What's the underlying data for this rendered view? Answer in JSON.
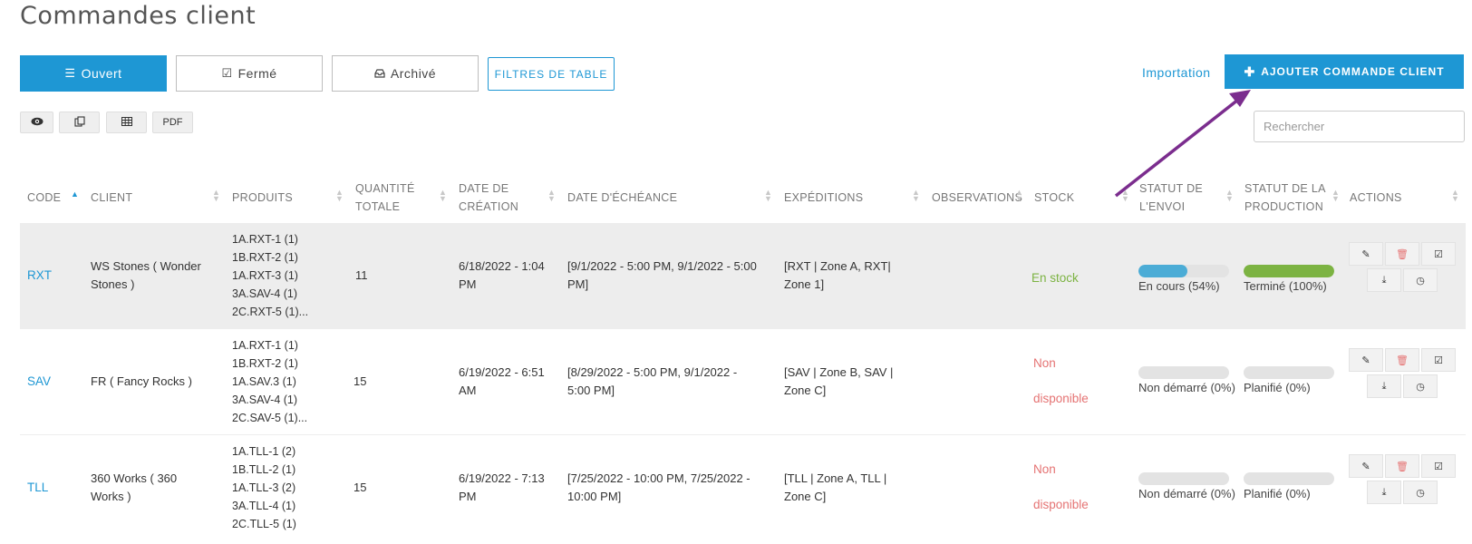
{
  "page": {
    "title": "Commandes client"
  },
  "tabs": {
    "open": {
      "label": "Ouvert",
      "icon": "list-icon"
    },
    "closed": {
      "label": "Fermé",
      "icon": "checkbox-icon"
    },
    "archived": {
      "label": "Archivé",
      "icon": "inbox-icon"
    }
  },
  "toolbar": {
    "filters_label": "FILTRES DE TABLE",
    "import_label": "Importation",
    "add_label": "AJOUTER COMMANDE CLIENT",
    "pdf_label": "PDF",
    "search_placeholder": "Rechercher"
  },
  "table": {
    "headers": {
      "code": "CODE",
      "client": "CLIENT",
      "products": "PRODUITS",
      "qty_l1": "QUANTITÉ",
      "qty_l2": "TOTALE",
      "created_l1": "DATE DE",
      "created_l2": "CRÉATION",
      "due": "DATE D'ÉCHÉANCE",
      "shipments": "EXPÉDITIONS",
      "observations": "OBSERVATIONS",
      "stock": "STOCK",
      "ship_status_l1": "STATUT DE",
      "ship_status_l2": "L'ENVOI",
      "prod_status_l1": "STATUT DE LA",
      "prod_status_l2": "PRODUCTION",
      "actions": "ACTIONS"
    },
    "sort_column": "CODE",
    "rows": [
      {
        "code": "RXT",
        "client_l1": "WS Stones ( Wonder",
        "client_l2": "Stones )",
        "products": [
          "1A.RXT-1 (1)",
          "1B.RXT-2 (1)",
          "1A.RXT-3 (1)",
          "3A.SAV-4 (1)",
          "2C.RXT-5 (1)..."
        ],
        "qty": "11",
        "created_l1": "6/18/2022 - 1:04",
        "created_l2": "PM",
        "due_l1": "[9/1/2022 - 5:00 PM, 9/1/2022 - 5:00",
        "due_l2": "PM]",
        "ship_l1": "[RXT | Zone A, RXT|",
        "ship_l2": "Zone 1]",
        "stock_l1": "En stock",
        "stock_l2": "",
        "stock_color": "#7cb342",
        "ship_status_label": "En cours (54%)",
        "ship_progress": 54,
        "ship_color": "#4bacd6",
        "prod_status_label": "Terminé (100%)",
        "prod_progress": 100,
        "prod_color": "#7cb342"
      },
      {
        "code": "SAV",
        "client_l1": "FR ( Fancy Rocks )",
        "client_l2": "",
        "products": [
          "1A.RXT-1 (1)",
          "1B.RXT-2 (1)",
          "1A.SAV.3 (1)",
          "3A.SAV-4 (1)",
          "2C.SAV-5 (1)..."
        ],
        "qty": "15",
        "created_l1": "6/19/2022 - 6:51",
        "created_l2": "AM",
        "due_l1": "[8/29/2022 - 5:00 PM, 9/1/2022 -",
        "due_l2": "5:00 PM]",
        "ship_l1": "[SAV | Zone B, SAV |",
        "ship_l2": "Zone C]",
        "stock_l1": "Non",
        "stock_l2": "disponible",
        "stock_color": "#e57373",
        "ship_status_label": "Non démarré (0%)",
        "ship_progress": 0,
        "ship_color": "#4bacd6",
        "prod_status_label": "Planifié (0%)",
        "prod_progress": 0,
        "prod_color": "#7cb342"
      },
      {
        "code": "TLL",
        "client_l1": "360 Works ( 360",
        "client_l2": "Works )",
        "products": [
          "1A.TLL-1 (2)",
          "1B.TLL-2 (1)",
          "1A.TLL-3 (2)",
          "3A.TLL-4 (1)",
          "2C.TLL-5 (1)"
        ],
        "qty": "15",
        "created_l1": "6/19/2022 - 7:13",
        "created_l2": "PM",
        "due_l1": "[7/25/2022 - 10:00 PM, 7/25/2022 -",
        "due_l2": "10:00 PM]",
        "ship_l1": "[TLL | Zone A, TLL |",
        "ship_l2": "Zone C]",
        "stock_l1": "Non",
        "stock_l2": "disponible",
        "stock_color": "#e57373",
        "ship_status_label": "Non démarré (0%)",
        "ship_progress": 0,
        "ship_color": "#4bacd6",
        "prod_status_label": "Planifié (0%)",
        "prod_progress": 0,
        "prod_color": "#7cb342"
      }
    ]
  },
  "colors": {
    "accent": "#1e97d4",
    "arrow": "#7b2d8e",
    "in_stock": "#7cb342",
    "out_of_stock": "#e57373"
  }
}
